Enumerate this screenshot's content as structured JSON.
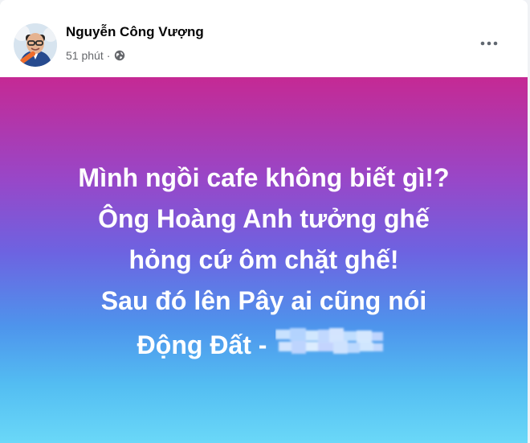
{
  "post": {
    "author": "Nguyễn Công Vượng",
    "time": "51 phút",
    "separator": "·",
    "audience_icon": "globe-icon",
    "menu_icon": "more-options-icon",
    "banner_lines": [
      "Mình ngồi cafe không biết gì!?",
      "Ông Hoàng Anh tưởng ghế",
      "hỏng cứ ôm chặt ghế!",
      "Sau đó lên Pây ai cũng nói"
    ],
    "banner_last_line": "Động Đất -",
    "colors": {
      "banner_top": "#c52994",
      "banner_middle": "#6d63e1",
      "banner_bottom": "#6ad8f8",
      "text_primary": "#050505",
      "text_secondary": "#65676b"
    }
  }
}
